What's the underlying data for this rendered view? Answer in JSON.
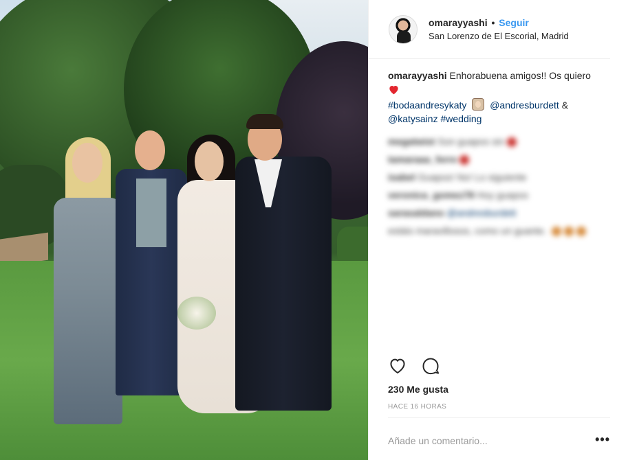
{
  "post": {
    "username": "omarayyashi",
    "separator": "•",
    "follow_label": "Seguir",
    "location": "San Lorenzo de El Escorial, Madrid"
  },
  "caption": {
    "username": "omarayyashi",
    "text": "Enhorabuena amigos!! Os quiero",
    "hashtag1": "#bodaandresykaty",
    "mention1": "@andresburdett",
    "ampersand": "&",
    "mention2": "@katysainz",
    "hashtag2": "#wedding",
    "emoji_heart": "red-heart",
    "emoji_bride": "bride-with-veil"
  },
  "blurred_comments": [
    {
      "user": "megatwist",
      "text": "Son guapos sin",
      "emoji": "heart"
    },
    {
      "user": "tamaraaa_ferre",
      "text": "",
      "emoji": "heart"
    },
    {
      "user": "isabel",
      "text": "Guapos! No! Lo siguiente",
      "emoji": ""
    },
    {
      "user": "veronica_gomez78",
      "text": "Hoy guapos",
      "emoji": ""
    },
    {
      "user": "sarasaldano",
      "mention": "@andresburdett",
      "text": "estáis maravillosos, como un guante.",
      "emoji": "orange"
    }
  ],
  "actions": {
    "like_icon": "heart-outline-icon",
    "comment_icon": "comment-bubble-icon"
  },
  "likes": "230 Me gusta",
  "timestamp": "HACE 16 HORAS",
  "comment_box": {
    "placeholder": "Añade un comentario...",
    "more_label": "•••"
  },
  "colors": {
    "link": "#3897f0",
    "hashtag": "#003569",
    "heart": "#ed4956",
    "border": "#efefef"
  }
}
